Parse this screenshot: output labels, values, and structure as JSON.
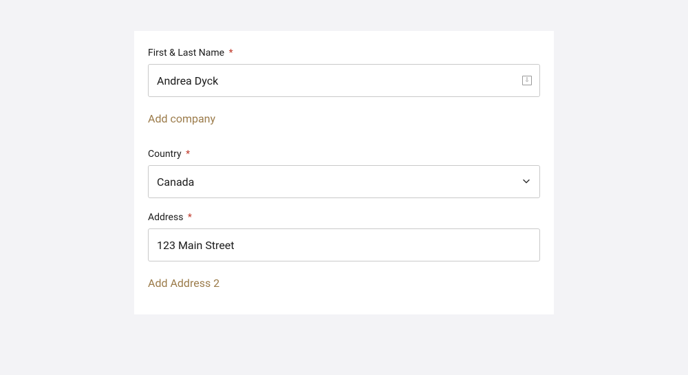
{
  "form": {
    "name": {
      "label": "First & Last Name",
      "required": "*",
      "value": "Andrea Dyck"
    },
    "add_company_label": "Add company",
    "country": {
      "label": "Country",
      "required": "*",
      "value": "Canada"
    },
    "address": {
      "label": "Address",
      "required": "*",
      "value": "123 Main Street"
    },
    "add_address2_label": "Add Address 2"
  }
}
